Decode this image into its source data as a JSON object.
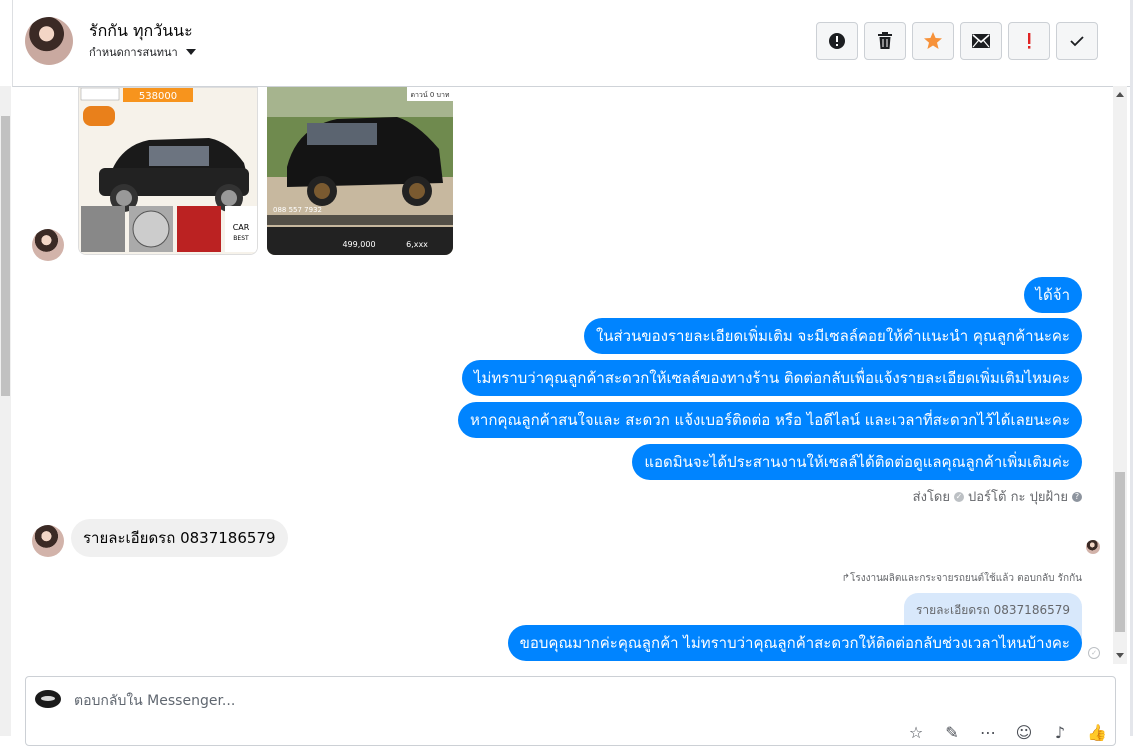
{
  "header": {
    "name": "รักกัน ทุกวันนะ",
    "subtitle": "กำหนดการสนทนา",
    "buttons": {
      "info": "!",
      "delete": "🗑",
      "star": "★",
      "mail": "✉",
      "important": "!",
      "done": "✓"
    }
  },
  "colors": {
    "outgoing_bubble": "#0084ff",
    "incoming_bubble": "#f0f0f0",
    "star": "#f7923a",
    "important": "#e02424"
  },
  "images": [
    {
      "price": "538000",
      "phone": "088 557 7932",
      "badge": "CAR BEST SELLER"
    },
    {
      "price": "499,000",
      "phone": "088 557 7932",
      "down": "ดาวน์ 0 บาท",
      "installment": "6,xxx"
    }
  ],
  "messages_out": [
    "ได้จ้า",
    "ในส่วนของรายละเอียดเพิ่มเติม จะมีเซลล์คอยให้คำแนะนำ คุณลูกค้านะคะ",
    "ไม่ทราบว่าคุณลูกค้าสะดวกให้เซลล์ของทางร้าน ติดต่อกลับเพื่อแจ้งรายละเอียดเพิ่มเติมไหมคะ",
    "หากคุณลูกค้าสนใจและ สะดวก แจ้งเบอร์ติดต่อ หรือ ไอดีไลน์ และเวลาที่สะดวกไว้ได้เลยนะคะ",
    "แอดมินจะได้ประสานงานให้เซลล์ได้ติดต่อดูแลคุณลูกค้าเพิ่มเติมค่ะ"
  ],
  "sent_by": {
    "prefix": "ส่งโดย",
    "name": "ปอร์โต้ กะ ปุยฝ้าย",
    "help": "?"
  },
  "message_in": "รายละเอียดรถ 0837186579",
  "reply": {
    "meta": "↱โรงงานผลิตและกระจายรถยนต์ใช้แล้ว ตอบกลับ รักกัน",
    "quoted": "รายละเอียดรถ 0837186579",
    "text": "ขอบคุณมากค่ะคุณลูกค้า ไม่ทราบว่าคุณลูกค้าสะดวกให้ติดต่อกลับช่วงเวลาไหนบ้างคะ"
  },
  "composer": {
    "placeholder": "ตอบกลับใน Messenger..."
  }
}
